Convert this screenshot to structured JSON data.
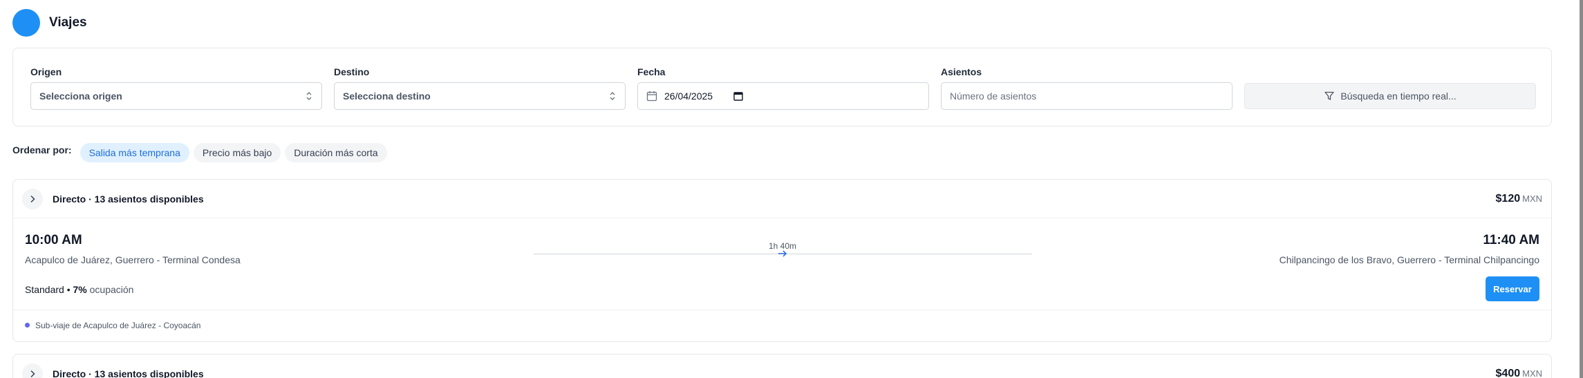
{
  "header": {
    "title": "Viajes"
  },
  "filters": {
    "origin": {
      "label": "Origen",
      "value": "Selecciona origen"
    },
    "destination": {
      "label": "Destino",
      "value": "Selecciona destino"
    },
    "date": {
      "label": "Fecha",
      "value": "26/04/2025"
    },
    "seats": {
      "label": "Asientos",
      "placeholder": "Número de asientos"
    },
    "realtime_label": "Búsqueda en tiempo real..."
  },
  "sort": {
    "label": "Ordenar por:",
    "options": [
      "Salida más temprana",
      "Precio más bajo",
      "Duración más corta"
    ],
    "active": "Salida más temprana"
  },
  "trips": [
    {
      "summary": "Directo · 13 asientos disponibles",
      "price": "$120",
      "currency": "MXN",
      "departure_time": "10:00 AM",
      "departure_place": "Acapulco de Juárez, Guerrero - Terminal Condesa",
      "duration": "1h 40m",
      "arrival_time": "11:40 AM",
      "arrival_place": "Chilpancingo de los Bravo, Guerrero - Terminal Chilpancingo",
      "bus_class": "Standard",
      "occupancy": "7%",
      "occupancy_label": "ocupación",
      "reserve_label": "Reservar",
      "subtrip": "Sub-viaje de Acapulco de Juárez - Coyoacán"
    },
    {
      "summary": "Directo · 13 asientos disponibles",
      "price": "$400",
      "currency": "MXN"
    }
  ],
  "colors": {
    "accent": "#1e90f5",
    "chip_active_bg": "#e0f0ff",
    "dot": "#6366f1"
  }
}
